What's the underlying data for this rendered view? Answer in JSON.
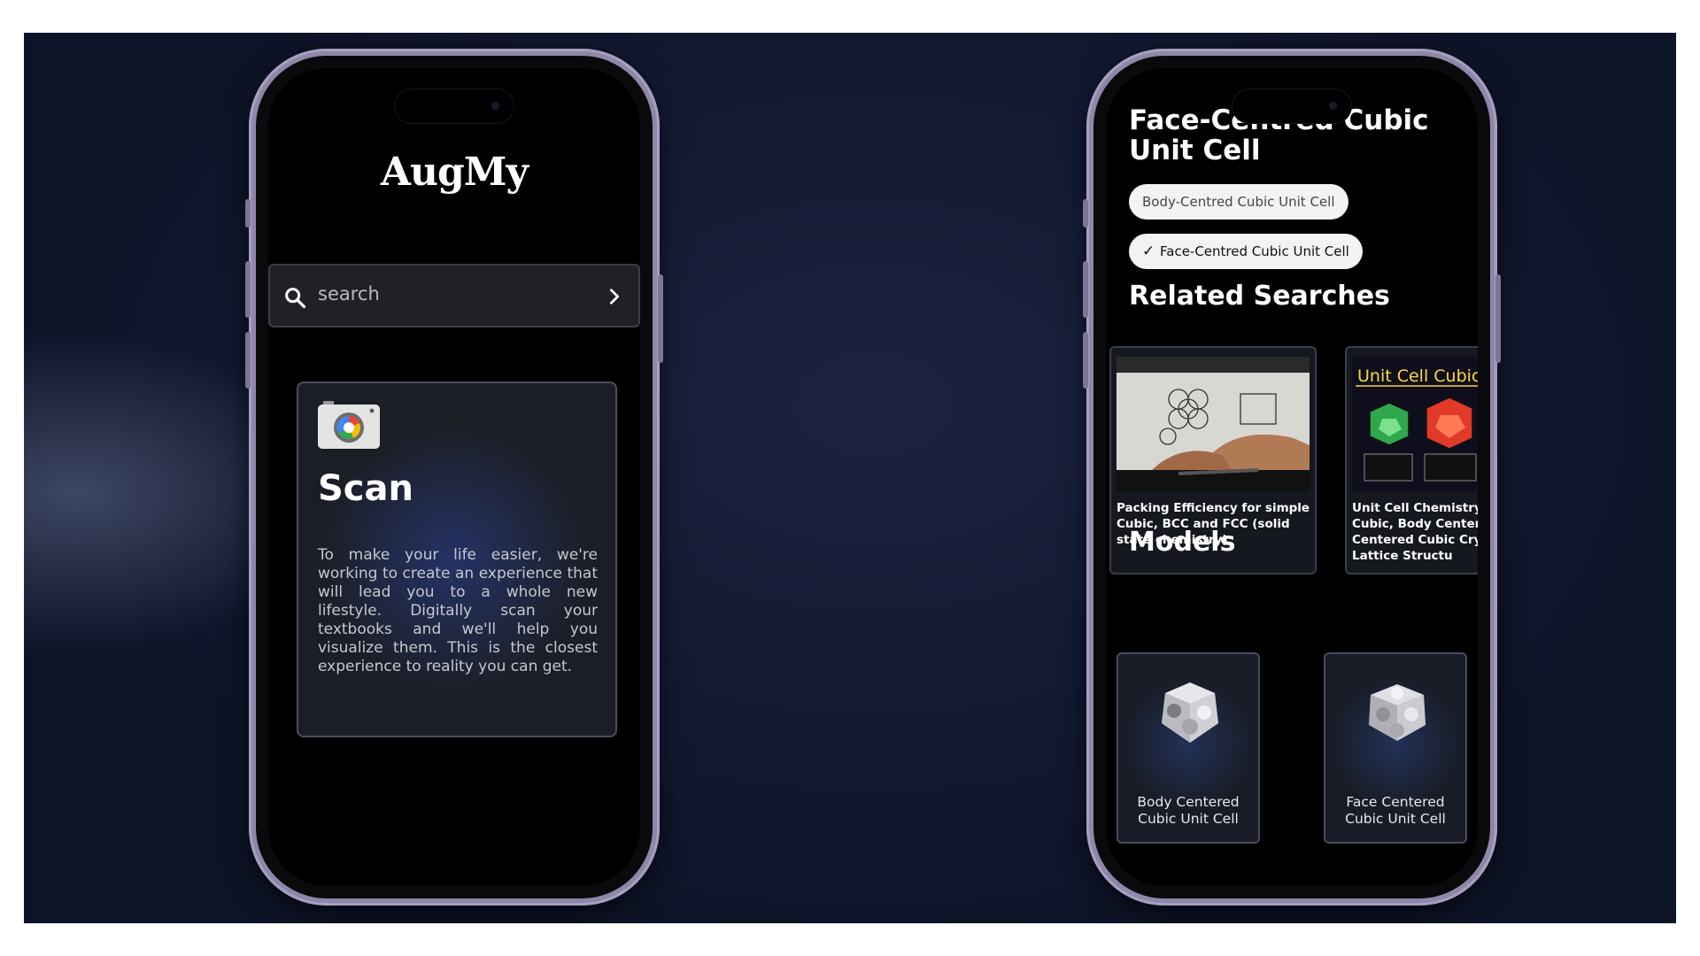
{
  "left_phone": {
    "app_title": "AugMy",
    "search": {
      "placeholder": "search"
    },
    "scan_card": {
      "title": "Scan",
      "description": "To make your life easier, we're working to create an experience that will lead you to a whole new lifestyle. Digitally scan your textbooks and we'll help you visualize them. This is the closest experience to reality you can get."
    }
  },
  "right_phone": {
    "title": "Face-Centred Cubic Unit Cell",
    "chips": [
      {
        "label": "Body-Centred Cubic Unit Cell",
        "selected": false
      },
      {
        "label": "Face-Centred Cubic Unit Cell",
        "selected": true
      }
    ],
    "related_searches": {
      "heading": "Related Searches",
      "items": [
        {
          "title": "Packing Efficiency for simple Cubic, BCC and FCC (solid state chemistry)"
        },
        {
          "title": "Unit Cell Chemistry  Simple Cubic, Body Centered Face Centered Cubic Crystal Lattice Structu",
          "thumb_caption": "Unit Cell Cubic Stru"
        }
      ]
    },
    "models": {
      "heading": "Models",
      "items": [
        {
          "label": "Body Centered Cubic Unit Cell"
        },
        {
          "label": "Face Centered Cubic Unit Cell"
        }
      ]
    }
  },
  "colors": {
    "background": "#131a33",
    "phone_frame": "#8f87a8",
    "card_border": "#4a4e5a",
    "text_primary": "#ffffff"
  },
  "icons": [
    "search-icon",
    "chevron-right-icon",
    "camera-icon",
    "check-icon",
    "cube-model-icon"
  ]
}
